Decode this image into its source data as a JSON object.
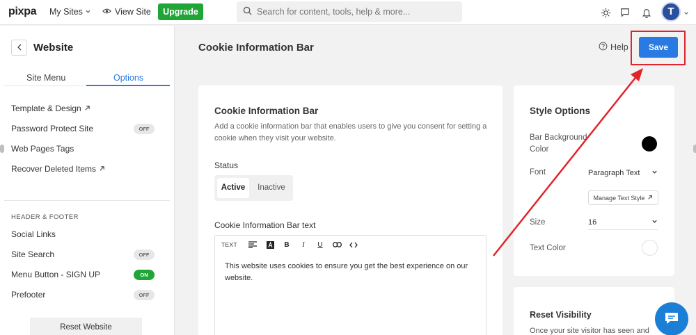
{
  "topbar": {
    "logo": "pixpa",
    "my_sites": "My Sites",
    "view_site": "View Site",
    "upgrade": "Upgrade",
    "search_placeholder": "Search for content, tools, help & more...",
    "avatar_initial": "T"
  },
  "sidebar": {
    "title": "Website",
    "tabs": [
      "Site Menu",
      "Options"
    ],
    "active_tab": "Options",
    "items": [
      {
        "label": "Template & Design",
        "external": true
      },
      {
        "label": "Password Protect Site",
        "toggle": "OFF"
      },
      {
        "label": "Web Pages Tags"
      },
      {
        "label": "Recover Deleted Items",
        "external": true
      }
    ],
    "section_label": "HEADER & FOOTER",
    "footer_items": [
      {
        "label": "Social Links"
      },
      {
        "label": "Site Search",
        "toggle": "OFF"
      },
      {
        "label": "Menu Button - SIGN UP",
        "toggle": "ON"
      },
      {
        "label": "Prefooter",
        "toggle": "OFF"
      }
    ],
    "reset_button": "Reset Website"
  },
  "header": {
    "title": "Cookie Information Bar",
    "help": "Help",
    "save": "Save"
  },
  "main_card": {
    "title": "Cookie Information Bar",
    "description": "Add a cookie information bar that enables users to give you consent for setting a cookie when they visit your website.",
    "status_label": "Status",
    "status_options": [
      "Active",
      "Inactive"
    ],
    "status_selected": "Active",
    "text_label": "Cookie Information Bar text",
    "toolbar_text": "TEXT",
    "editor_content": "This website uses cookies to ensure you get the best experience on our website."
  },
  "style_options": {
    "title": "Style Options",
    "bar_background_label": "Bar Background Color",
    "bar_background_color": "#000000",
    "font_label": "Font",
    "font_value": "Paragraph Text",
    "manage_text_style": "Manage Text Style",
    "size_label": "Size",
    "size_value": "16",
    "text_color_label": "Text Color",
    "text_color": "#ffffff"
  },
  "reset_visibility": {
    "title": "Reset Visibility",
    "description": "Once your site visitor has seen and"
  },
  "colors": {
    "accent": "#2a7ae4",
    "upgrade_green": "#1fa637",
    "highlight_red": "#e0242b",
    "chat_blue": "#1b7fd6"
  }
}
